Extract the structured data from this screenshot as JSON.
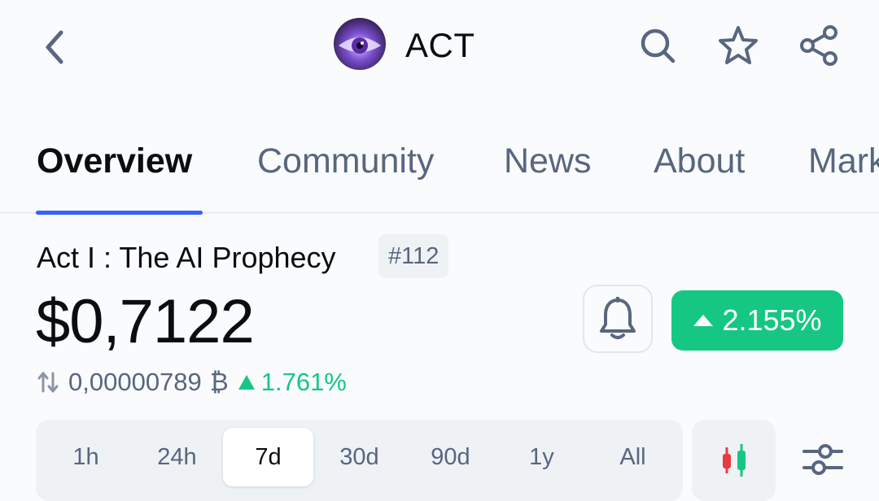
{
  "header": {
    "symbol": "ACT",
    "icons": {
      "back": "chevron-left-icon",
      "search": "search-icon",
      "favorite": "star-icon",
      "share": "share-icon"
    }
  },
  "tabs": [
    {
      "label": "Overview",
      "active": true
    },
    {
      "label": "Community",
      "active": false
    },
    {
      "label": "News",
      "active": false
    },
    {
      "label": "About",
      "active": false
    },
    {
      "label": "Markets",
      "active": false
    }
  ],
  "coin": {
    "name": "Act I : The AI Prophecy",
    "rank": "#112",
    "price": "$0,7122",
    "btc_price": "0,00000789",
    "btc_symbol": "₿",
    "btc_change": "1.761%",
    "change_24h": "2.155%"
  },
  "range": {
    "options": [
      "1h",
      "24h",
      "7d",
      "30d",
      "90d",
      "1y",
      "All"
    ],
    "selected": "7d"
  },
  "colors": {
    "accent": "#3861fb",
    "positive": "#16c784",
    "negative": "#ea3943",
    "muted_text": "#58667e"
  }
}
